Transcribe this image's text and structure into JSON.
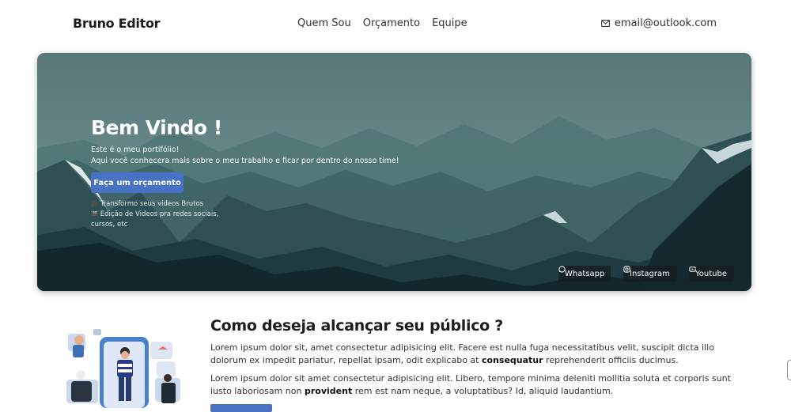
{
  "nav": {
    "brand": "Bruno Editor",
    "links": [
      "Quem Sou",
      "Orçamento",
      "Equipe"
    ],
    "email": "email@outlook.com"
  },
  "hero": {
    "title": "Bem Vindo !",
    "subtitle_line1": "Este é o meu portifólio!",
    "subtitle_line2": "Aqui você conhecera mais sobre o meu trabalho e ficar por dentro do nosso time!",
    "cta_label": "Faça um orçamento",
    "note1": "Transformo seus videos Brutos",
    "note2": "Edição de Videos pra redes sociais, cursos, etc",
    "social": {
      "whatsapp": "Whatsapp",
      "instagram": "Instagram",
      "youtube": "Youtube"
    }
  },
  "section": {
    "title": "Como deseja alcançar seu público ?",
    "p1_a": "Lorem ipsum dolor sit, amet consectetur adipisicing elit. Facere est nulla fuga necessitatibus velit, suscipit dicta illo dolorum ex impedit pariatur, repellat ipsam, odit explicabo at ",
    "p1_bold": "consequatur",
    "p1_b": " reprehenderit officiis ducimus.",
    "p2_a": "Lorem ipsum dolor sit amet consectetur adipisicing elit. Libero, tempore minima deleniti mollitia soluta et corporis sunt iusto laboriosam non ",
    "p2_bold": "provident",
    "p2_b": " rem est nam neque, a voluptatibus? Id, aliquid laudantium."
  },
  "colors": {
    "accent": "#4a72c4",
    "hero_top": "#5f7e7d",
    "hero_bottom": "#0f2a2e"
  }
}
